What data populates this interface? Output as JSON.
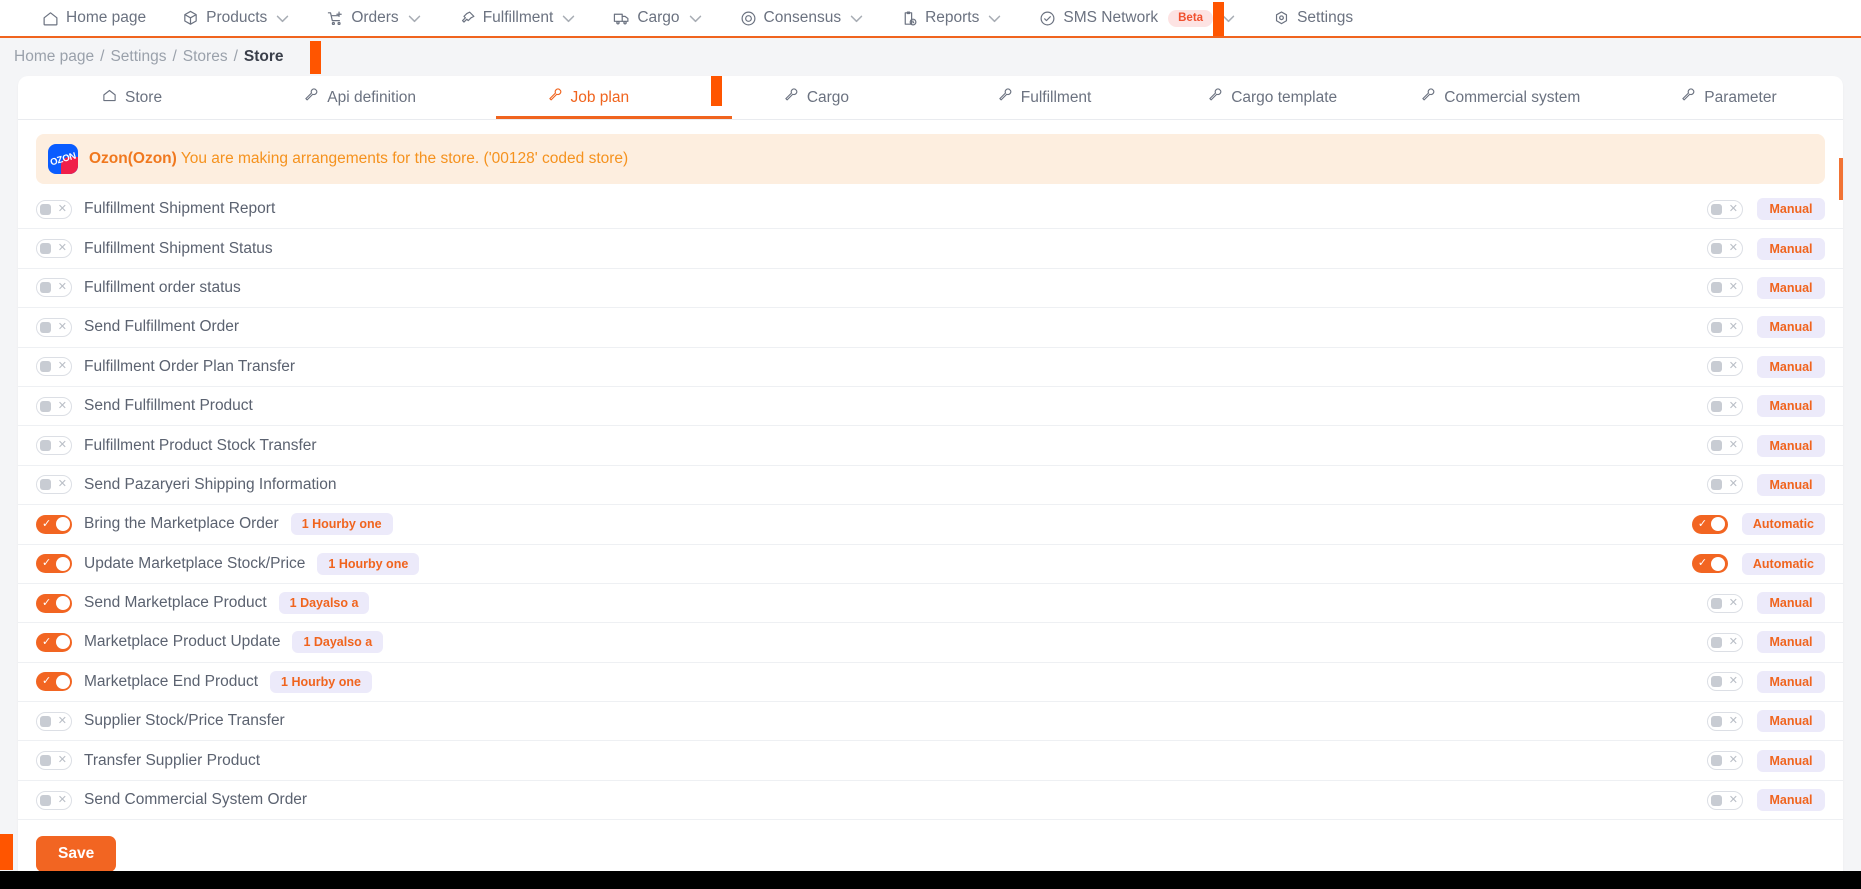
{
  "topnav": {
    "items": [
      {
        "label": "Home page",
        "icon": "home-icon",
        "caret": false
      },
      {
        "label": "Products",
        "icon": "box-icon",
        "caret": true
      },
      {
        "label": "Orders",
        "icon": "cart-plus-icon",
        "caret": true
      },
      {
        "label": "Fulfillment",
        "icon": "pin-icon",
        "caret": true
      },
      {
        "label": "Cargo",
        "icon": "truck-icon",
        "caret": true
      },
      {
        "label": "Consensus",
        "icon": "target-icon",
        "caret": true
      },
      {
        "label": "Reports",
        "icon": "clipboard-clock-icon",
        "caret": true
      },
      {
        "label": "SMS Network",
        "icon": "check-circle-icon",
        "caret": true,
        "badge": "Beta"
      },
      {
        "label": "Settings",
        "icon": "hexagon-gear-icon",
        "caret": false
      }
    ]
  },
  "breadcrumb": {
    "items": [
      "Home page",
      "Settings",
      "Stores",
      "Store"
    ],
    "separator": "/"
  },
  "tabs": [
    {
      "label": "Store",
      "icon": "home-icon",
      "active": false
    },
    {
      "label": "Api definition",
      "icon": "wrench-icon",
      "active": false
    },
    {
      "label": "Job plan",
      "icon": "wrench-icon",
      "active": true
    },
    {
      "label": "Cargo",
      "icon": "wrench-icon",
      "active": false
    },
    {
      "label": "Fulfillment",
      "icon": "wrench-icon",
      "active": false
    },
    {
      "label": "Cargo template",
      "icon": "wrench-icon",
      "active": false
    },
    {
      "label": "Commercial system",
      "icon": "wrench-icon",
      "active": false
    },
    {
      "label": "Parameter",
      "icon": "wrench-icon",
      "active": false
    }
  ],
  "banner": {
    "logo_text": "OZON",
    "strong": "Ozon(Ozon)",
    "message": " You are making arrangements for the store. ('00128' coded store)"
  },
  "rows": [
    {
      "label": "Fulfillment Shipment Report",
      "enabled": false,
      "schedule": "",
      "mode": "Manual"
    },
    {
      "label": "Fulfillment Shipment Status",
      "enabled": false,
      "schedule": "",
      "mode": "Manual"
    },
    {
      "label": "Fulfillment order status",
      "enabled": false,
      "schedule": "",
      "mode": "Manual"
    },
    {
      "label": "Send Fulfillment Order",
      "enabled": false,
      "schedule": "",
      "mode": "Manual"
    },
    {
      "label": "Fulfillment Order Plan Transfer",
      "enabled": false,
      "schedule": "",
      "mode": "Manual"
    },
    {
      "label": "Send Fulfillment Product",
      "enabled": false,
      "schedule": "",
      "mode": "Manual"
    },
    {
      "label": "Fulfillment Product Stock Transfer",
      "enabled": false,
      "schedule": "",
      "mode": "Manual"
    },
    {
      "label": "Send Pazaryeri Shipping Information",
      "enabled": false,
      "schedule": "",
      "mode": "Manual"
    },
    {
      "label": "Bring the Marketplace Order",
      "enabled": true,
      "schedule": "1 Hourby one",
      "mode": "Automatic"
    },
    {
      "label": "Update Marketplace Stock/Price",
      "enabled": true,
      "schedule": "1 Hourby one",
      "mode": "Automatic"
    },
    {
      "label": "Send Marketplace Product",
      "enabled": true,
      "schedule": "1 Dayalso a",
      "mode": "Manual"
    },
    {
      "label": "Marketplace Product Update",
      "enabled": true,
      "schedule": "1 Dayalso a",
      "mode": "Manual"
    },
    {
      "label": "Marketplace End Product",
      "enabled": true,
      "schedule": "1 Hourby one",
      "mode": "Manual"
    },
    {
      "label": "Supplier Stock/Price Transfer",
      "enabled": false,
      "schedule": "",
      "mode": "Manual"
    },
    {
      "label": "Transfer Supplier Product",
      "enabled": false,
      "schedule": "",
      "mode": "Manual"
    },
    {
      "label": "Send Commercial System Order",
      "enabled": false,
      "schedule": "",
      "mode": "Manual"
    }
  ],
  "footer": {
    "save_label": "Save"
  },
  "colors": {
    "accent": "#f0641e",
    "switch_on": "#f26522",
    "chip_bg": "#eceafa",
    "banner_bg": "#fdeedf",
    "marker": "#ff5500"
  }
}
